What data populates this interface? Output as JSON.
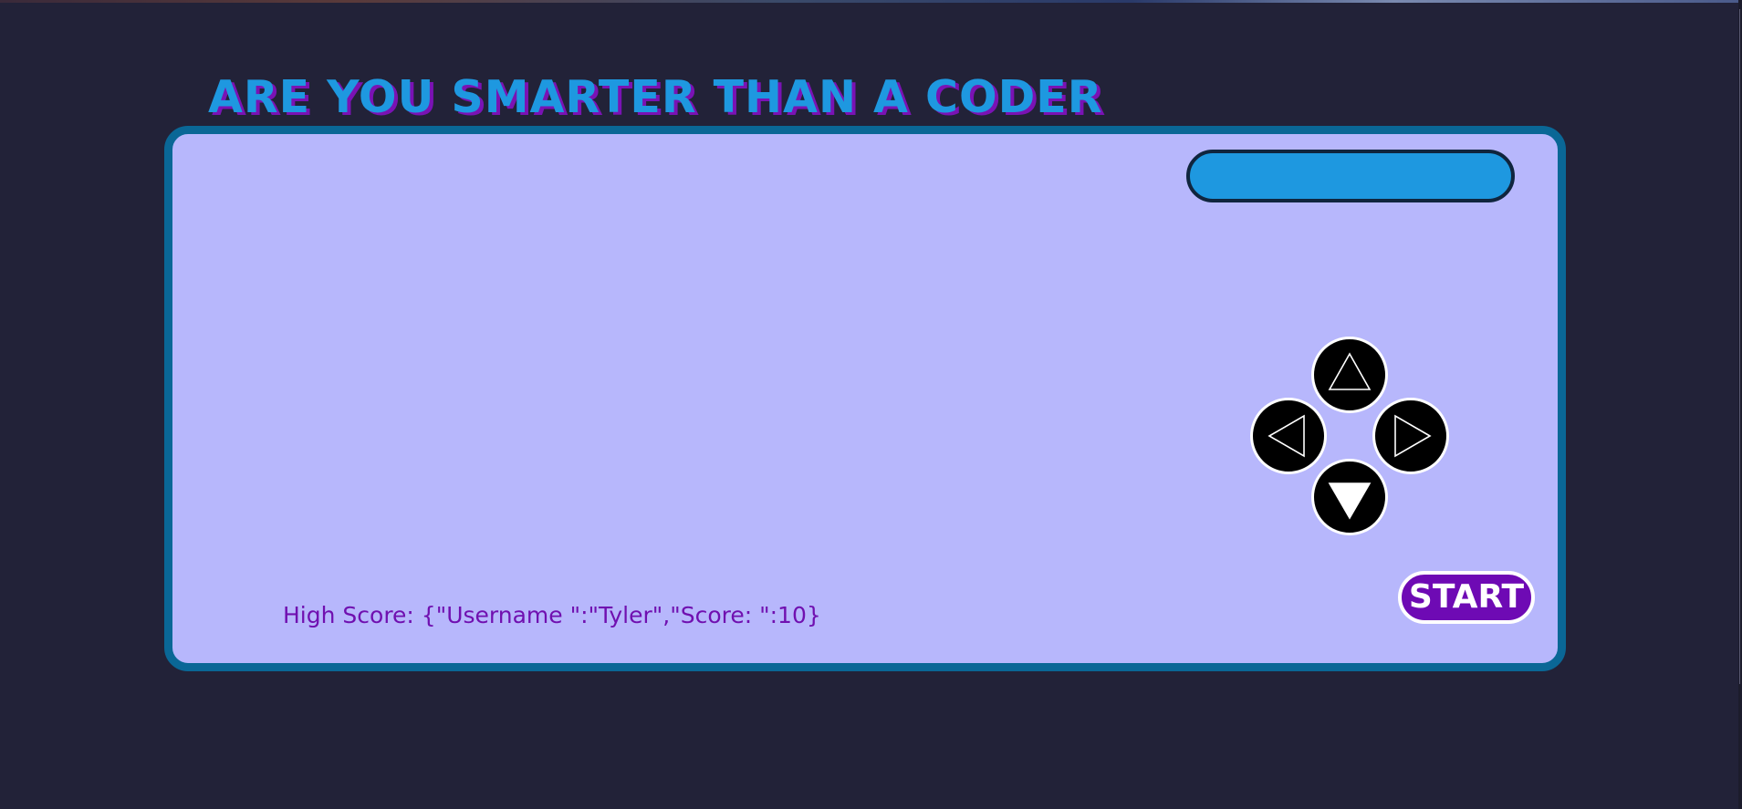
{
  "title": "ARE YOU SMARTER THAN A CODER",
  "timer_bar": {
    "label": ""
  },
  "controls": {
    "up": "up-arrow",
    "left": "left-arrow",
    "right": "right-arrow",
    "down": "down-arrow"
  },
  "start_label": "START",
  "high_score_text": "High Score: {\"Username \":\"Tyler\",\"Score: \":10}",
  "colors": {
    "background": "#222238",
    "console_fill": "#b7b7fc",
    "console_border": "#0a6796",
    "title": "#1e98e0",
    "title_shadow": "#7a12b4",
    "timer_bar": "#1e98e0",
    "start_button": "#6e0ab4",
    "high_score_text": "#7010b0"
  }
}
